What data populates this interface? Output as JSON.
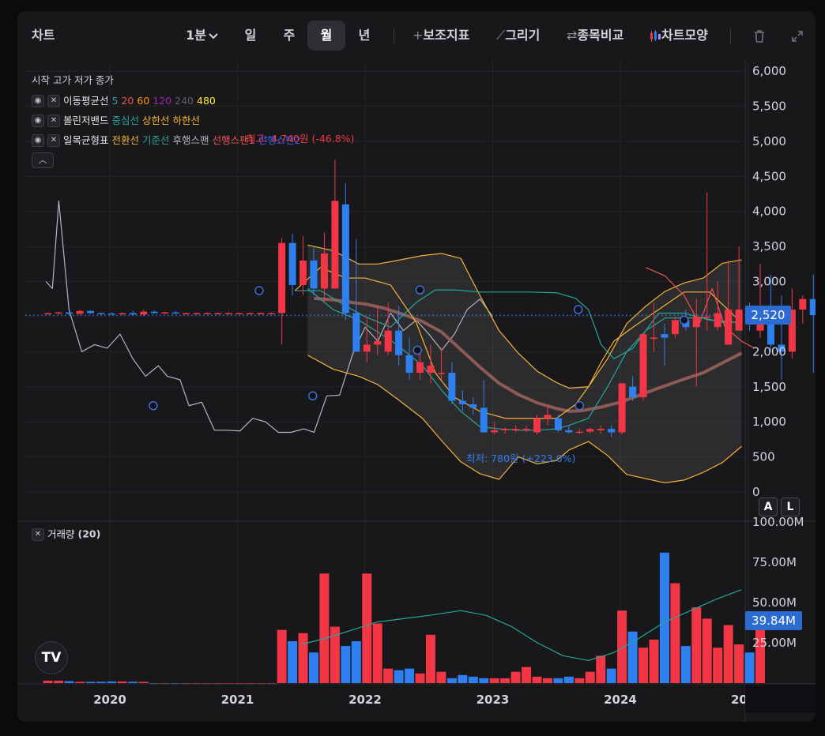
{
  "toolbar": {
    "title": "차트",
    "interval": "1분",
    "interval_chevron": "chevron-down-icon",
    "periods": [
      "일",
      "주",
      "월",
      "년"
    ],
    "active_period": "월",
    "indicators": "보조지표",
    "draw": "그리기",
    "compare": "종목비교",
    "chart_style": "차트모양",
    "icons": [
      "plus-icon",
      "pencil-icon",
      "swap-icon",
      "candles-icon",
      "trash-icon",
      "expand-icon"
    ]
  },
  "legend": {
    "ohlc": "시작 고가 저가 종가",
    "ma": {
      "name": "이동평균선",
      "periods": [
        {
          "label": "5",
          "color": "#26a69a"
        },
        {
          "label": "20",
          "color": "#ef5350"
        },
        {
          "label": "60",
          "color": "#ff9800"
        },
        {
          "label": "120",
          "color": "#9c27b0"
        },
        {
          "label": "240",
          "color": "#5d606b"
        },
        {
          "label": "480",
          "color": "#ffeb3b"
        }
      ]
    },
    "bollinger": {
      "name": "볼린저밴드",
      "items": [
        {
          "label": "중심선",
          "color": "#26a69a"
        },
        {
          "label": "상한선",
          "color": "#f5b335"
        },
        {
          "label": "하한선",
          "color": "#f5b335"
        }
      ]
    },
    "ichimoku": {
      "name": "일목균형표",
      "items": [
        {
          "label": "전환선",
          "color": "#f5b335"
        },
        {
          "label": "기준선",
          "color": "#26a69a"
        },
        {
          "label": "후행스팬",
          "color": "#b2b5be"
        },
        {
          "label": "선행스팬1",
          "color": "#ef5350"
        },
        {
          "label": "선행스팬2",
          "color": "#2962ff"
        }
      ]
    },
    "eye_icon": "eye-off-icon",
    "close_icon": "close-icon",
    "collapse_icon": "chevron-up-icon"
  },
  "annotations": {
    "high": "최고: 4,740원 (-46.8%)",
    "low": "최저: 780원 (+223.0%)"
  },
  "price_tag": "2,520",
  "volume_tag": "39.84M",
  "volume_legend": {
    "name": "거래량",
    "period": "(20)"
  },
  "scale_buttons": [
    "A",
    "L"
  ],
  "logo": "TV",
  "colors": {
    "up": "#f23645",
    "down": "#2e7ff0",
    "background": "#18181b"
  },
  "chart_data": {
    "type": "candlestick",
    "x_ticks": [
      "2020",
      "2021",
      "2022",
      "2023",
      "2024",
      "20"
    ],
    "y_ticks": [
      "0",
      "500",
      "1,000",
      "1,500",
      "2,000",
      "2,500",
      "3,000",
      "3,500",
      "4,000",
      "4,500",
      "5,000",
      "5,500",
      "6,000"
    ],
    "ylim": [
      0,
      6000
    ],
    "volume_ticks": [
      "25.00M",
      "50.00M",
      "75.00M",
      "100.00M"
    ],
    "volume_ylim": [
      0,
      100
    ],
    "last_price": 2520,
    "start_year": 2019.5,
    "step": 0.0833,
    "candles": [
      [
        2550,
        2560,
        2540,
        2550
      ],
      [
        2550,
        2570,
        2530,
        2560
      ],
      [
        2560,
        2580,
        2520,
        2540
      ],
      [
        2540,
        2600,
        2520,
        2580
      ],
      [
        2580,
        2590,
        2540,
        2550
      ],
      [
        2550,
        2560,
        2530,
        2545
      ],
      [
        2545,
        2560,
        2530,
        2540
      ],
      [
        2540,
        2560,
        2520,
        2550
      ],
      [
        2550,
        2580,
        2520,
        2530
      ],
      [
        2530,
        2600,
        2510,
        2570
      ],
      [
        2570,
        2590,
        2540,
        2550
      ],
      [
        2550,
        2570,
        2540,
        2560
      ],
      [
        2560,
        2580,
        2540,
        2550
      ],
      [
        2550,
        2560,
        2540,
        2550
      ],
      [
        2550,
        2560,
        2540,
        2550
      ],
      [
        2550,
        2560,
        2540,
        2550
      ],
      [
        2550,
        2560,
        2540,
        2550
      ],
      [
        2550,
        2560,
        2540,
        2550
      ],
      [
        2550,
        2560,
        2540,
        2550
      ],
      [
        2550,
        2560,
        2540,
        2550
      ],
      [
        2550,
        2560,
        2540,
        2550
      ],
      [
        2550,
        2560,
        2540,
        2550
      ],
      [
        2550,
        3620,
        2100,
        3550
      ],
      [
        3550,
        3680,
        2800,
        2950
      ],
      [
        2950,
        3650,
        2800,
        3300
      ],
      [
        3300,
        3500,
        2800,
        2900
      ],
      [
        2900,
        3700,
        2700,
        3400
      ],
      [
        2900,
        4740,
        2900,
        4150
      ],
      [
        4100,
        4400,
        2450,
        2550
      ],
      [
        2550,
        3600,
        2000,
        2000
      ],
      [
        2000,
        2500,
        1850,
        2100
      ],
      [
        2100,
        2650,
        1950,
        2150
      ],
      [
        2000,
        2700,
        1950,
        2300
      ],
      [
        2300,
        2650,
        1800,
        1950
      ],
      [
        1950,
        2200,
        1600,
        1700
      ],
      [
        1700,
        2050,
        1600,
        1850
      ],
      [
        1700,
        2100,
        1550,
        1800
      ],
      [
        1700,
        2050,
        1600,
        1700
      ],
      [
        1700,
        1850,
        1250,
        1300
      ],
      [
        1300,
        1450,
        1150,
        1250
      ],
      [
        1250,
        1350,
        1100,
        1200
      ],
      [
        1200,
        1600,
        850,
        850
      ],
      [
        850,
        1000,
        820,
        880
      ],
      [
        880,
        920,
        830,
        900
      ],
      [
        880,
        950,
        850,
        900
      ],
      [
        880,
        950,
        850,
        900
      ],
      [
        850,
        1100,
        820,
        1050
      ],
      [
        1050,
        1250,
        950,
        1100
      ],
      [
        1050,
        1100,
        850,
        880
      ],
      [
        880,
        950,
        830,
        850
      ],
      [
        850,
        900,
        820,
        860
      ],
      [
        860,
        920,
        830,
        900
      ],
      [
        880,
        950,
        830,
        900
      ],
      [
        900,
        950,
        780,
        850
      ],
      [
        850,
        1550,
        820,
        1550
      ],
      [
        1500,
        1650,
        1300,
        1350
      ],
      [
        1350,
        2250,
        1300,
        2250
      ],
      [
        2200,
        2700,
        2000,
        2200
      ],
      [
        2250,
        2400,
        1800,
        2200
      ],
      [
        2250,
        2500,
        2200,
        2450
      ],
      [
        2450,
        2600,
        2300,
        2350
      ],
      [
        2350,
        2750,
        1500,
        2500
      ],
      [
        2500,
        4270,
        2300,
        2500
      ],
      [
        2350,
        3000,
        2300,
        2550
      ],
      [
        2100,
        3300,
        2100,
        2600
      ],
      [
        2300,
        3500,
        2300,
        2600
      ],
      [
        2500,
        2700,
        2300,
        2400
      ],
      [
        2300,
        3250,
        2200,
        2600
      ],
      [
        2600,
        3100,
        2000,
        2100
      ],
      [
        2100,
        2800,
        1600,
        2000
      ],
      [
        2000,
        2900,
        1900,
        2600
      ],
      [
        2600,
        2800,
        2400,
        2750
      ],
      [
        2750,
        3100,
        1700,
        2520
      ]
    ],
    "volumes": [
      1.5,
      1.5,
      1.2,
      0.8,
      0.8,
      0.8,
      1.0,
      1.0,
      0.8,
      0.8,
      0,
      0,
      0,
      0,
      0,
      0,
      0,
      0,
      0,
      0,
      0,
      0,
      33,
      26,
      31,
      19,
      68,
      35,
      23,
      26,
      68,
      37,
      9,
      8,
      9,
      6,
      30,
      7,
      3,
      5,
      4,
      3,
      3,
      3,
      7,
      10,
      4,
      3,
      3,
      4,
      3,
      7,
      17,
      9,
      45,
      32,
      22,
      27,
      81,
      62,
      23,
      47,
      40,
      22,
      36,
      24,
      19,
      39.84
    ],
    "ma_long": [
      [
        2021.6,
        2760
      ],
      [
        2021.75,
        2740
      ],
      [
        2021.9,
        2700
      ],
      [
        2022.0,
        2680
      ],
      [
        2022.15,
        2620
      ],
      [
        2022.3,
        2530
      ],
      [
        2022.45,
        2430
      ],
      [
        2022.6,
        2280
      ],
      [
        2022.75,
        2030
      ],
      [
        2022.9,
        1780
      ],
      [
        2023.05,
        1550
      ],
      [
        2023.2,
        1390
      ],
      [
        2023.35,
        1270
      ],
      [
        2023.5,
        1190
      ],
      [
        2023.6,
        1150
      ],
      [
        2023.7,
        1160
      ],
      [
        2023.85,
        1210
      ],
      [
        2024.0,
        1280
      ],
      [
        2024.15,
        1380
      ],
      [
        2024.3,
        1480
      ],
      [
        2024.5,
        1610
      ],
      [
        2024.65,
        1700
      ],
      [
        2024.8,
        1840
      ],
      [
        2024.95,
        1980
      ]
    ],
    "bb_upper": [
      [
        2021.55,
        3520
      ],
      [
        2021.75,
        3440
      ],
      [
        2021.95,
        3250
      ],
      [
        2022.1,
        3250
      ],
      [
        2022.25,
        3300
      ],
      [
        2022.45,
        3370
      ],
      [
        2022.6,
        3400
      ],
      [
        2022.75,
        3330
      ],
      [
        2022.9,
        2800
      ],
      [
        2023.05,
        2300
      ],
      [
        2023.2,
        1980
      ],
      [
        2023.35,
        1720
      ],
      [
        2023.5,
        1560
      ],
      [
        2023.6,
        1480
      ],
      [
        2023.75,
        1500
      ],
      [
        2023.9,
        1900
      ],
      [
        2024.05,
        2400
      ],
      [
        2024.2,
        2650
      ],
      [
        2024.35,
        2860
      ],
      [
        2024.5,
        2980
      ],
      [
        2024.65,
        3050
      ],
      [
        2024.8,
        3260
      ],
      [
        2024.95,
        3310
      ]
    ],
    "bb_lower": [
      [
        2021.55,
        1950
      ],
      [
        2021.75,
        1750
      ],
      [
        2021.95,
        1650
      ],
      [
        2022.1,
        1530
      ],
      [
        2022.25,
        1330
      ],
      [
        2022.45,
        1050
      ],
      [
        2022.6,
        730
      ],
      [
        2022.75,
        430
      ],
      [
        2022.9,
        260
      ],
      [
        2023.05,
        180
      ],
      [
        2023.2,
        500
      ],
      [
        2023.35,
        400
      ],
      [
        2023.5,
        450
      ],
      [
        2023.6,
        600
      ],
      [
        2023.75,
        720
      ],
      [
        2023.9,
        520
      ],
      [
        2024.05,
        250
      ],
      [
        2024.2,
        190
      ],
      [
        2024.35,
        130
      ],
      [
        2024.5,
        170
      ],
      [
        2024.65,
        280
      ],
      [
        2024.8,
        420
      ],
      [
        2024.95,
        650
      ]
    ],
    "bb_mid": [
      [
        2021.55,
        2900
      ],
      [
        2021.75,
        2600
      ],
      [
        2021.95,
        2450
      ],
      [
        2022.1,
        2280
      ],
      [
        2022.25,
        2100
      ],
      [
        2022.45,
        1800
      ],
      [
        2022.6,
        1450
      ],
      [
        2022.75,
        1150
      ],
      [
        2022.9,
        930
      ],
      [
        2023.05,
        900
      ],
      [
        2023.2,
        880
      ],
      [
        2023.35,
        880
      ],
      [
        2023.5,
        900
      ],
      [
        2023.6,
        950
      ],
      [
        2023.75,
        1050
      ],
      [
        2023.9,
        1500
      ],
      [
        2024.05,
        2000
      ],
      [
        2024.2,
        2300
      ],
      [
        2024.35,
        2480
      ],
      [
        2024.5,
        2480
      ],
      [
        2024.65,
        2480
      ],
      [
        2024.8,
        2420
      ],
      [
        2024.95,
        2420
      ]
    ],
    "lagging": [
      [
        2019.5,
        3000
      ],
      [
        2019.55,
        2900
      ],
      [
        2019.6,
        4150
      ],
      [
        2019.68,
        2600
      ],
      [
        2019.78,
        2000
      ],
      [
        2019.88,
        2100
      ],
      [
        2019.98,
        2050
      ],
      [
        2020.08,
        2250
      ],
      [
        2020.18,
        1900
      ],
      [
        2020.28,
        1650
      ],
      [
        2020.38,
        1800
      ],
      [
        2020.45,
        1650
      ],
      [
        2020.55,
        1600
      ],
      [
        2020.62,
        1230
      ],
      [
        2020.72,
        1280
      ],
      [
        2020.82,
        880
      ],
      [
        2020.92,
        880
      ],
      [
        2021.02,
        870
      ],
      [
        2021.12,
        1050
      ],
      [
        2021.22,
        1000
      ],
      [
        2021.32,
        850
      ],
      [
        2021.42,
        850
      ],
      [
        2021.52,
        900
      ],
      [
        2021.6,
        850
      ],
      [
        2021.7,
        1370
      ],
      [
        2021.8,
        1380
      ],
      [
        2021.9,
        1950
      ],
      [
        2022.0,
        2350
      ],
      [
        2022.1,
        2150
      ],
      [
        2022.2,
        2550
      ],
      [
        2022.3,
        2300
      ],
      [
        2022.4,
        2450
      ],
      [
        2022.5,
        2250
      ],
      [
        2022.6,
        2020
      ],
      [
        2022.7,
        2250
      ],
      [
        2022.8,
        2600
      ],
      [
        2022.9,
        2750
      ],
      [
        2023.0,
        2500
      ]
    ],
    "baseline": [
      [
        2021.45,
        2870
      ],
      [
        2021.65,
        2870
      ],
      [
        2021.85,
        2650
      ],
      [
        2022.0,
        2500
      ],
      [
        2022.2,
        2350
      ],
      [
        2022.4,
        2700
      ],
      [
        2022.55,
        2880
      ],
      [
        2022.7,
        2880
      ],
      [
        2022.9,
        2850
      ],
      [
        2023.1,
        2850
      ],
      [
        2023.3,
        2850
      ],
      [
        2023.5,
        2840
      ],
      [
        2023.65,
        2760
      ],
      [
        2023.75,
        2600
      ],
      [
        2023.85,
        2100
      ],
      [
        2023.95,
        1900
      ],
      [
        2024.1,
        2050
      ],
      [
        2024.3,
        2550
      ],
      [
        2024.5,
        2550
      ],
      [
        2024.7,
        2450
      ],
      [
        2024.9,
        2420
      ]
    ],
    "conversion": [
      [
        2021.45,
        2870
      ],
      [
        2021.65,
        3200
      ],
      [
        2021.85,
        3050
      ],
      [
        2022.0,
        3050
      ],
      [
        2022.2,
        2950
      ],
      [
        2022.4,
        2420
      ],
      [
        2022.55,
        1700
      ],
      [
        2022.7,
        1350
      ],
      [
        2022.9,
        1150
      ],
      [
        2023.1,
        1050
      ],
      [
        2023.3,
        1050
      ],
      [
        2023.5,
        1050
      ],
      [
        2023.65,
        1250
      ],
      [
        2023.75,
        1500
      ],
      [
        2023.85,
        1850
      ],
      [
        2023.95,
        2150
      ],
      [
        2024.1,
        2350
      ],
      [
        2024.3,
        2600
      ],
      [
        2024.5,
        2850
      ],
      [
        2024.7,
        2850
      ],
      [
        2024.9,
        2500
      ]
    ],
    "span1": [
      [
        2024.2,
        3200
      ],
      [
        2024.35,
        3080
      ],
      [
        2024.5,
        2800
      ],
      [
        2024.62,
        2400
      ],
      [
        2024.72,
        2900
      ],
      [
        2024.82,
        2350
      ],
      [
        2024.95,
        2150
      ],
      [
        2025.05,
        2050
      ]
    ],
    "volume_ma": [
      [
        2021.5,
        24
      ],
      [
        2021.7,
        28
      ],
      [
        2021.9,
        33
      ],
      [
        2022.1,
        38
      ],
      [
        2022.3,
        40
      ],
      [
        2022.5,
        42
      ],
      [
        2022.75,
        45
      ],
      [
        2022.95,
        42
      ],
      [
        2023.15,
        35
      ],
      [
        2023.35,
        25
      ],
      [
        2023.55,
        17
      ],
      [
        2023.75,
        14
      ],
      [
        2023.95,
        19
      ],
      [
        2024.15,
        28
      ],
      [
        2024.35,
        38
      ],
      [
        2024.55,
        45
      ],
      [
        2024.75,
        52
      ],
      [
        2024.95,
        58
      ]
    ]
  }
}
